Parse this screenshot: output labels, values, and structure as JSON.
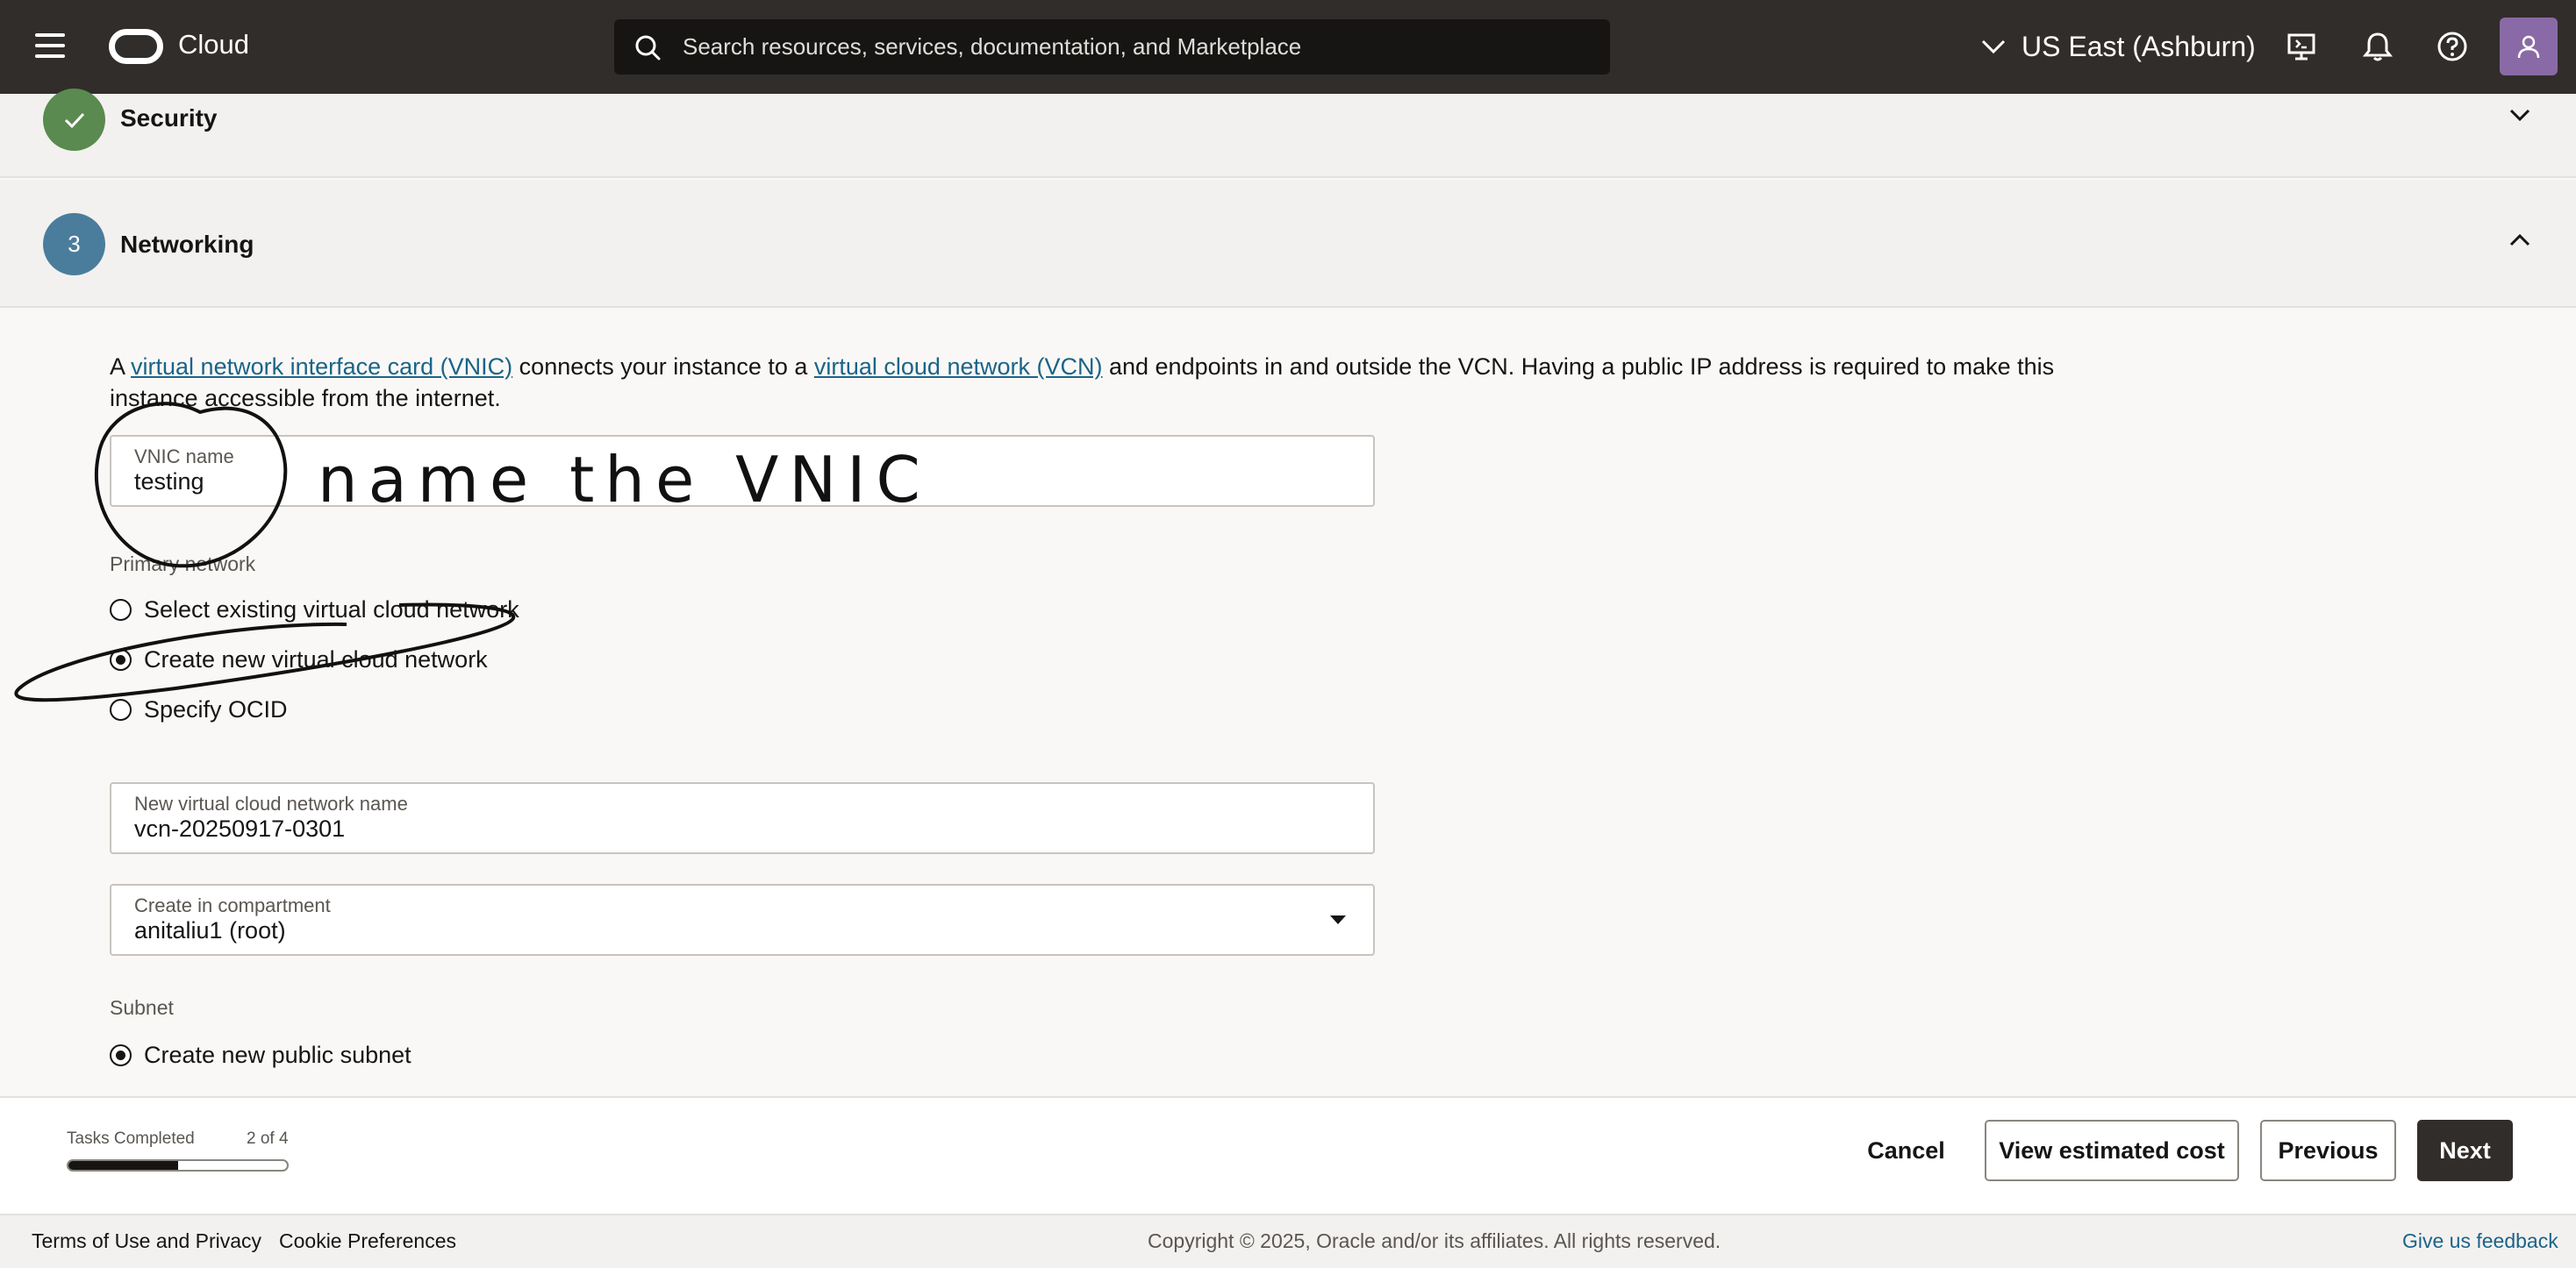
{
  "topbar": {
    "brand": "Cloud",
    "search_placeholder": "Search resources, services, documentation, and Marketplace",
    "region": "US East (Ashburn)",
    "icons": [
      "menu-icon",
      "oracle-logo",
      "search-icon",
      "chevron-down-icon",
      "cloud-shell-icon",
      "bell-icon",
      "help-icon",
      "user-icon"
    ]
  },
  "sections": {
    "security": {
      "title": "Security",
      "status": "completed"
    },
    "networking": {
      "title": "Networking",
      "step": "3"
    }
  },
  "networking": {
    "intro_prefix": "A ",
    "vnic_link": "virtual network interface card (VNIC)",
    "intro_middle": " connects your instance to a ",
    "vcn_link": "virtual cloud network (VCN)",
    "intro_suffix": " and endpoints in and outside the VCN. Having a public IP address is required to make this instance accessible from the internet.",
    "vnic_name_label": "VNIC name",
    "vnic_name_value": "testing",
    "primary_network_label": "Primary network",
    "primary_network_options": [
      {
        "label": "Select existing virtual cloud network",
        "checked": false
      },
      {
        "label": "Create new virtual cloud network",
        "checked": true
      },
      {
        "label": "Specify OCID",
        "checked": false
      }
    ],
    "new_vcn_label": "New virtual cloud network name",
    "new_vcn_value": "vcn-20250917-0301",
    "compartment_label": "Create in compartment",
    "compartment_value": "anitaliu1 (root)",
    "subnet_label": "Subnet",
    "subnet_option": "Create new public subnet"
  },
  "annotation": {
    "text": "name the VNIC"
  },
  "taskbar": {
    "tasks_label": "Tasks Completed",
    "tasks_count": "2 of 4",
    "progress_fraction": 0.5,
    "cancel": "Cancel",
    "view_cost": "View estimated cost",
    "previous": "Previous",
    "next": "Next"
  },
  "footer": {
    "terms": "Terms of Use and Privacy",
    "cookies": "Cookie Preferences",
    "copyright": "Copyright © 2025, Oracle and/or its affiliates. All rights reserved.",
    "feedback": "Give us feedback"
  }
}
